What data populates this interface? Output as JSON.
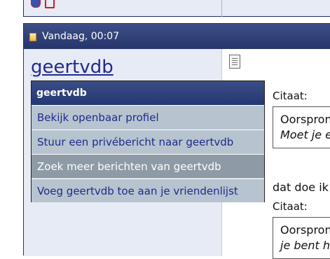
{
  "post": {
    "date": "Vandaag, 00:07",
    "username": "geertvdb"
  },
  "user_menu": {
    "title": "geertvdb",
    "items": [
      {
        "label": "Bekijk openbaar profiel"
      },
      {
        "label": "Stuur een privébericht naar geertvdb"
      },
      {
        "label": "Zoek meer berichten van geertvdb",
        "state": "hover"
      },
      {
        "label": "Voeg geertvdb toe aan je vriendenlijst"
      }
    ]
  },
  "content": {
    "quote1_label": "Citaat:",
    "quote1_line1": "Oorspronke",
    "quote1_line2": "Moet je ee",
    "body_text": "dat doe ik",
    "quote2_label": "Citaat:",
    "quote2_line1": "Oorspronke",
    "quote2_line2": "je bent hie"
  },
  "icons": [
    "globe-icon",
    "online-status-icon",
    "post-icon",
    "post-document-icon"
  ],
  "colors": {
    "header_bg": "#2f4079",
    "sidebar_bg": "#e7ebf5",
    "menu_bg": "#b7c4cf",
    "menu_hover_bg": "#8e9aa5",
    "link": "#22298f"
  }
}
